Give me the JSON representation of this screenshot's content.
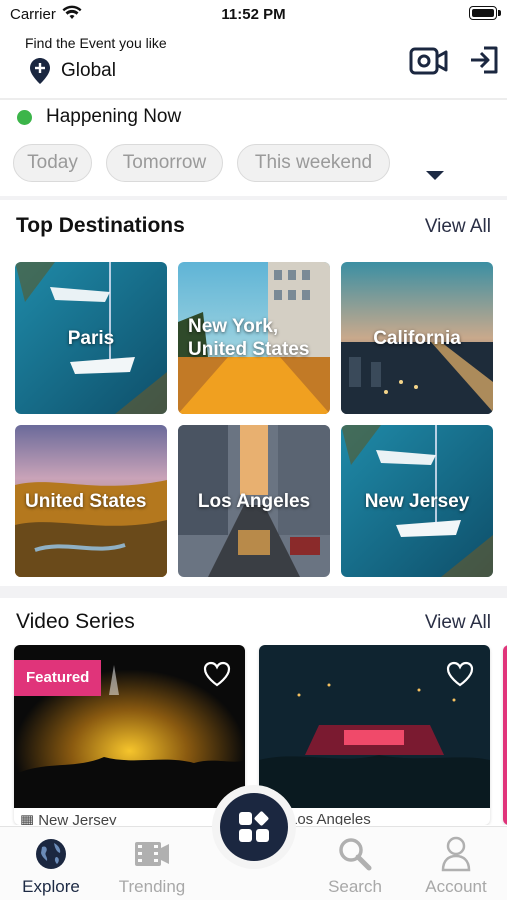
{
  "status_bar": {
    "carrier": "Carrier",
    "time": "11:52 PM"
  },
  "header": {
    "prompt": "Find the Event you like",
    "location": "Global"
  },
  "happening": {
    "label": "Happening Now",
    "chips": [
      "Today",
      "Tomorrow",
      "This weekend"
    ]
  },
  "destinations": {
    "title": "Top Destinations",
    "view_all": "View All",
    "items": [
      {
        "label": "Paris",
        "theme": "sea"
      },
      {
        "label": "New York, United States",
        "theme": "street"
      },
      {
        "label": "California",
        "theme": "coast"
      },
      {
        "label": "United States",
        "theme": "valley"
      },
      {
        "label": "Los Angeles",
        "theme": "city"
      },
      {
        "label": "New Jersey",
        "theme": "sea"
      }
    ]
  },
  "video_series": {
    "title": "Video Series",
    "view_all": "View All",
    "items": [
      {
        "caption": "New Jersey",
        "badge": "Featured"
      },
      {
        "caption": "Los Angeles",
        "badge": ""
      }
    ]
  },
  "tab_bar": {
    "items": [
      {
        "label": "Explore",
        "icon": "globe-icon",
        "active": true
      },
      {
        "label": "Trending",
        "icon": "film-icon",
        "active": false
      },
      {
        "label": "Search",
        "icon": "search-icon",
        "active": false
      },
      {
        "label": "Account",
        "icon": "user-icon",
        "active": false
      }
    ]
  },
  "colors": {
    "navy": "#1b2740",
    "accent_pink": "#e0347a",
    "live_green": "#3cb54a"
  }
}
